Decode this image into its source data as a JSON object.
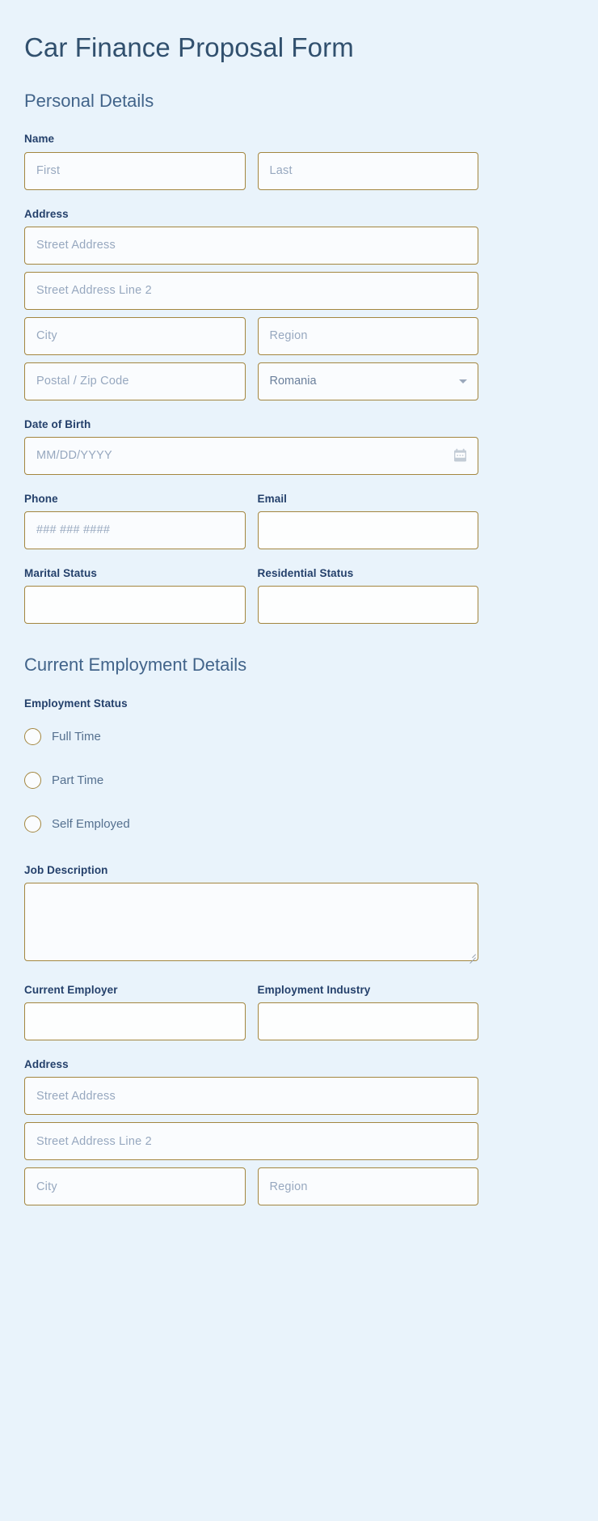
{
  "form": {
    "title": "Car Finance Proposal Form"
  },
  "personal": {
    "section_title": "Personal Details",
    "name": {
      "label": "Name",
      "first_placeholder": "First",
      "last_placeholder": "Last"
    },
    "address": {
      "label": "Address",
      "street_placeholder": "Street Address",
      "street2_placeholder": "Street Address Line 2",
      "city_placeholder": "City",
      "region_placeholder": "Region",
      "postal_placeholder": "Postal / Zip Code",
      "country_value": "Romania"
    },
    "dob": {
      "label": "Date of Birth",
      "placeholder": "MM/DD/YYYY",
      "icon": "calendar-icon"
    },
    "phone": {
      "label": "Phone",
      "placeholder": "### ### ####"
    },
    "email": {
      "label": "Email",
      "value": ""
    },
    "marital_status": {
      "label": "Marital Status",
      "value": ""
    },
    "residential_status": {
      "label": "Residential Status",
      "value": ""
    }
  },
  "employment": {
    "section_title": "Current Employment Details",
    "status": {
      "label": "Employment Status",
      "options": [
        {
          "label": "Full Time",
          "selected": false
        },
        {
          "label": "Part Time",
          "selected": false
        },
        {
          "label": "Self Employed",
          "selected": false
        }
      ]
    },
    "job_description": {
      "label": "Job Description",
      "value": ""
    },
    "current_employer": {
      "label": "Current Employer",
      "value": ""
    },
    "industry": {
      "label": "Employment Industry",
      "value": ""
    },
    "address": {
      "label": "Address",
      "street_placeholder": "Street Address",
      "street2_placeholder": "Street Address Line 2",
      "city_placeholder": "City",
      "region_placeholder": "Region"
    }
  },
  "colors": {
    "page_background": "#e9f3fb",
    "field_background": "#fafcfe",
    "field_border": "#a3863f",
    "title_text": "#31506e",
    "label_text": "#24406b",
    "placeholder_text": "#97a8bf"
  }
}
